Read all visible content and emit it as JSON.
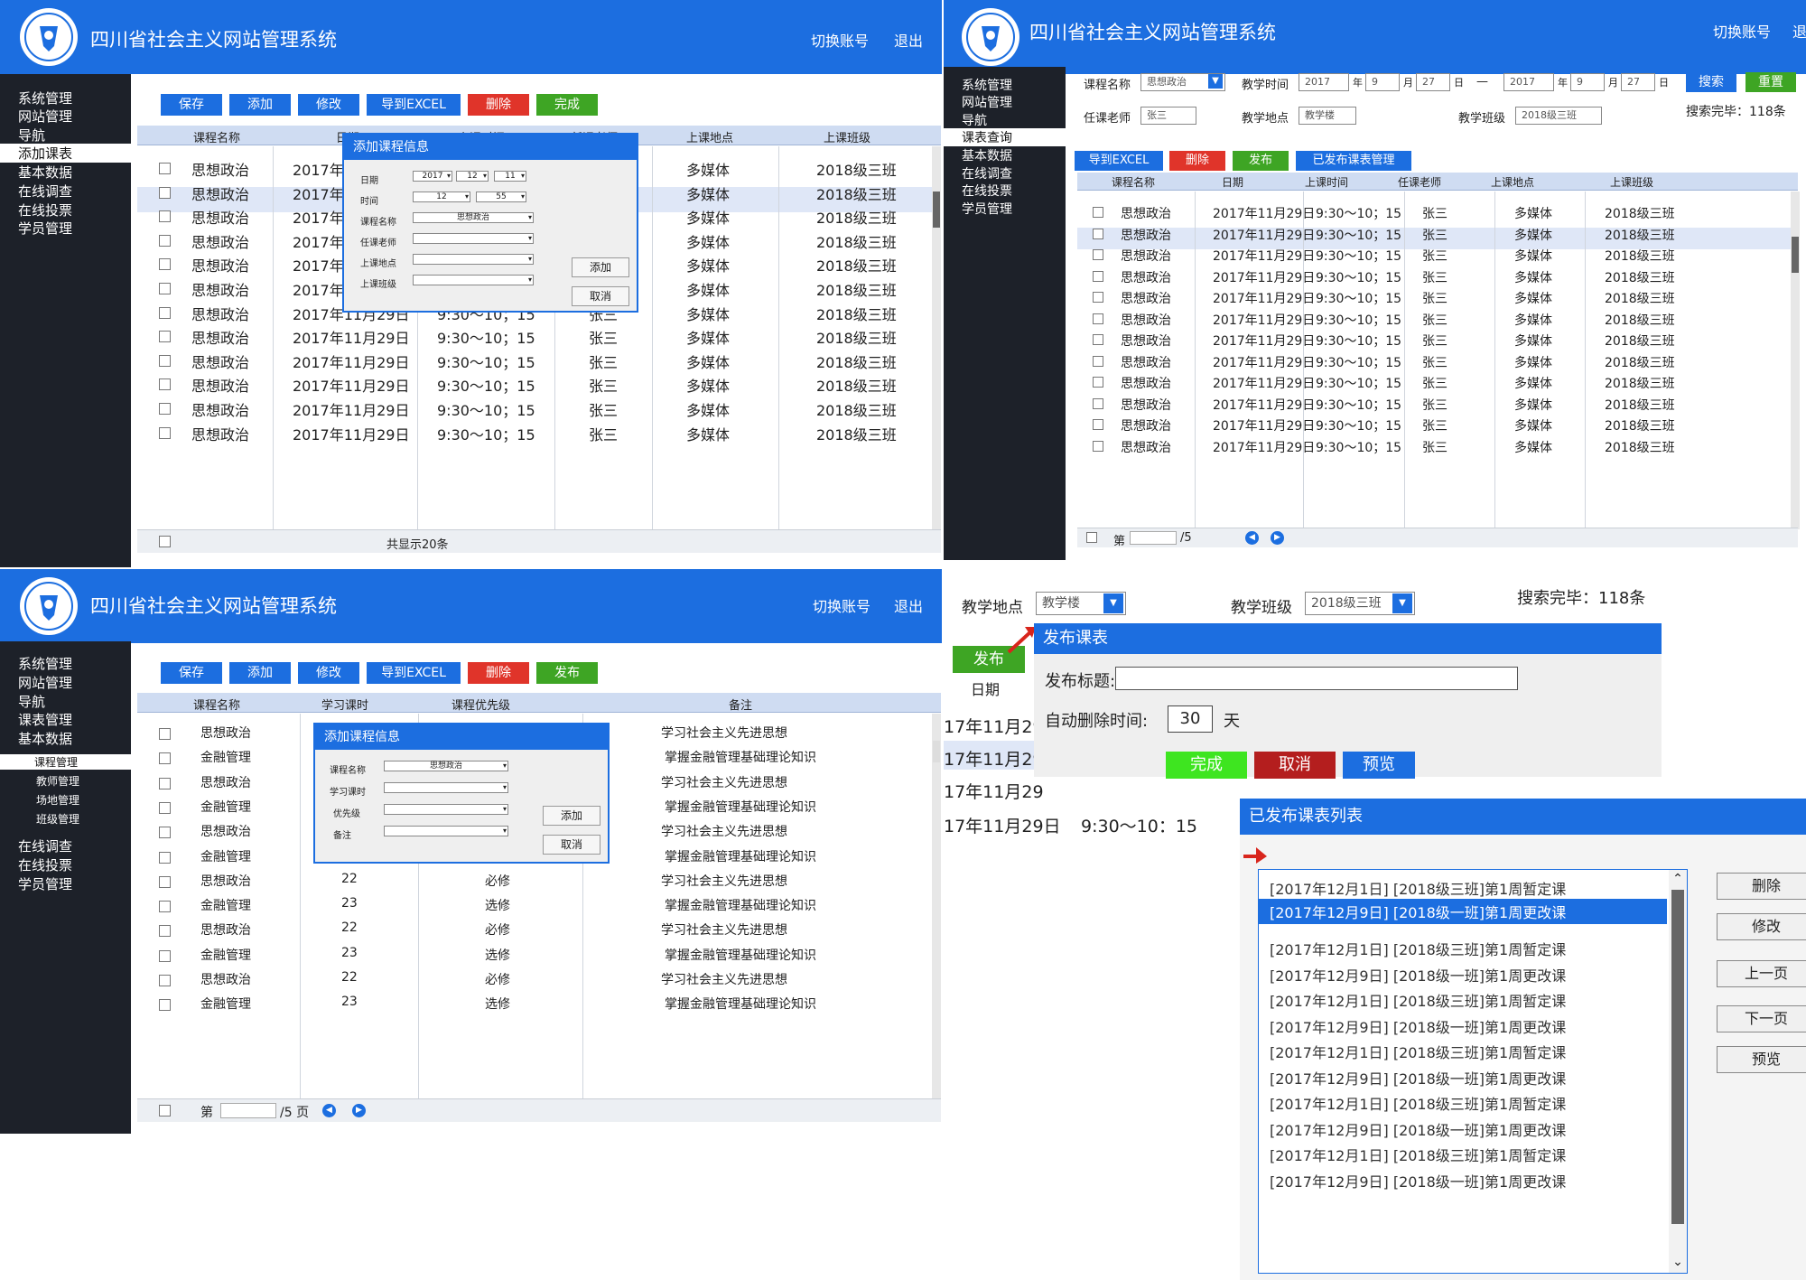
{
  "app": {
    "title": "四川省社会主义网站管理系统",
    "switch": "切换账号",
    "logout": "退出"
  },
  "p1": {
    "sidebar": [
      "系统管理",
      "网站管理",
      "导航",
      "添加课表",
      "基本数据",
      "在线调查",
      "在线投票",
      "学员管理"
    ],
    "toolbar": [
      "保存",
      "添加",
      "修改",
      "导到EXCEL",
      "删除",
      "完成"
    ],
    "columns": [
      "课程名称",
      "日期",
      "上课时间",
      "任课老师",
      "上课地点",
      "上课班级"
    ],
    "rows": [
      [
        "思想政治",
        "2017年11月29日",
        "9:30～10；15",
        "张三",
        "多媒体",
        "2018级三班"
      ],
      [
        "思想政治",
        "2017年11月29日",
        "9:30～10；15",
        "张三",
        "多媒体",
        "2018级三班"
      ],
      [
        "思想政治",
        "2017年11月29日",
        "9:30～10；15",
        "张三",
        "多媒体",
        "2018级三班"
      ],
      [
        "思想政治",
        "2017年11月29日",
        "9:30～10；15",
        "张三",
        "多媒体",
        "2018级三班"
      ],
      [
        "思想政治",
        "2017年11月29日",
        "9:30～10；15",
        "张三",
        "多媒体",
        "2018级三班"
      ],
      [
        "思想政治",
        "2017年11月29日",
        "9:30～10；15",
        "张三",
        "多媒体",
        "2018级三班"
      ],
      [
        "思想政治",
        "2017年11月29日",
        "9:30～10；15",
        "张三",
        "多媒体",
        "2018级三班"
      ],
      [
        "思想政治",
        "2017年11月29日",
        "9:30～10；15",
        "张三",
        "多媒体",
        "2018级三班"
      ],
      [
        "思想政治",
        "2017年11月29日",
        "9:30～10；15",
        "张三",
        "多媒体",
        "2018级三班"
      ],
      [
        "思想政治",
        "2017年11月29日",
        "9:30～10；15",
        "张三",
        "多媒体",
        "2018级三班"
      ],
      [
        "思想政治",
        "2017年11月29日",
        "9:30～10；15",
        "张三",
        "多媒体",
        "2018级三班"
      ],
      [
        "思想政治",
        "2017年11月29日",
        "9:30～10；15",
        "张三",
        "多媒体",
        "2018级三班"
      ]
    ],
    "footer": "共显示20条",
    "dialog": {
      "title": "添加课程信息",
      "date_label": "日期",
      "year": "2017",
      "month": "12",
      "day": "11",
      "time_label": "时间",
      "hour": "12",
      "minute": "55",
      "course_label": "课程名称",
      "course": "思想政治",
      "teacher_label": "任课老师",
      "place_label": "上课地点",
      "class_label": "上课班级",
      "add": "添加",
      "cancel": "取消"
    }
  },
  "p2": {
    "sidebar": [
      "系统管理",
      "网站管理",
      "导航",
      "课表查询",
      "基本数据",
      "在线调查",
      "在线投票",
      "学员管理"
    ],
    "filters": {
      "course_label": "课程名称",
      "course": "思想政治",
      "time_label": "教学时间",
      "y1": "2017",
      "m1": "9",
      "d1": "27",
      "y2": "2017",
      "m2": "9",
      "d2": "27",
      "u_year": "年",
      "u_month": "月",
      "u_day": "日",
      "dash": "—",
      "teacher_label": "任课老师",
      "teacher": "张三",
      "place_label": "教学地点",
      "place": "教学楼",
      "class_label": "教学班级",
      "class": "2018级三班",
      "search": "搜索",
      "reset": "重置",
      "result": "搜索完毕：118条"
    },
    "toolbar": [
      "导到EXCEL",
      "删除",
      "发布",
      "已发布课表管理"
    ],
    "columns": [
      "课程名称",
      "日期",
      "上课时间",
      "任课老师",
      "上课地点",
      "上课班级"
    ],
    "rows": [
      [
        "思想政治",
        "2017年11月29日",
        "9:30～10；15",
        "张三",
        "多媒体",
        "2018级三班"
      ],
      [
        "思想政治",
        "2017年11月29日",
        "9:30～10；15",
        "张三",
        "多媒体",
        "2018级三班"
      ],
      [
        "思想政治",
        "2017年11月29日",
        "9:30～10；15",
        "张三",
        "多媒体",
        "2018级三班"
      ],
      [
        "思想政治",
        "2017年11月29日",
        "9:30～10；15",
        "张三",
        "多媒体",
        "2018级三班"
      ],
      [
        "思想政治",
        "2017年11月29日",
        "9:30～10；15",
        "张三",
        "多媒体",
        "2018级三班"
      ],
      [
        "思想政治",
        "2017年11月29日",
        "9:30～10；15",
        "张三",
        "多媒体",
        "2018级三班"
      ],
      [
        "思想政治",
        "2017年11月29日",
        "9:30～10；15",
        "张三",
        "多媒体",
        "2018级三班"
      ],
      [
        "思想政治",
        "2017年11月29日",
        "9:30～10；15",
        "张三",
        "多媒体",
        "2018级三班"
      ],
      [
        "思想政治",
        "2017年11月29日",
        "9:30～10；15",
        "张三",
        "多媒体",
        "2018级三班"
      ],
      [
        "思想政治",
        "2017年11月29日",
        "9:30～10；15",
        "张三",
        "多媒体",
        "2018级三班"
      ],
      [
        "思想政治",
        "2017年11月29日",
        "9:30～10；15",
        "张三",
        "多媒体",
        "2018级三班"
      ],
      [
        "思想政治",
        "2017年11月29日",
        "9:30～10；15",
        "张三",
        "多媒体",
        "2018级三班"
      ]
    ],
    "footer": {
      "page_prefix": "第",
      "page_total": "/5"
    }
  },
  "p3": {
    "sidebar": [
      "系统管理",
      "网站管理",
      "导航",
      "课表管理",
      "基本数据"
    ],
    "sub": [
      "课程管理",
      "教师管理",
      "场地管理",
      "班级管理"
    ],
    "sidebar2": [
      "在线调查",
      "在线投票",
      "学员管理"
    ],
    "toolbar": [
      "保存",
      "添加",
      "修改",
      "导到EXCEL",
      "删除",
      "发布"
    ],
    "columns": [
      "课程名称",
      "学习课时",
      "课程优先级",
      "备注"
    ],
    "rows": [
      [
        "思想政治",
        "",
        "",
        "学习社会主义先进思想"
      ],
      [
        "金融管理",
        "",
        "",
        "掌握金融管理基础理论知识"
      ],
      [
        "思想政治",
        "",
        "",
        "学习社会主义先进思想"
      ],
      [
        "金融管理",
        "",
        "",
        "掌握金融管理基础理论知识"
      ],
      [
        "思想政治",
        "",
        "",
        "学习社会主义先进思想"
      ],
      [
        "金融管理",
        "23",
        "选修",
        "掌握金融管理基础理论知识"
      ],
      [
        "思想政治",
        "22",
        "必修",
        "学习社会主义先进思想"
      ],
      [
        "金融管理",
        "23",
        "选修",
        "掌握金融管理基础理论知识"
      ],
      [
        "思想政治",
        "22",
        "必修",
        "学习社会主义先进思想"
      ],
      [
        "金融管理",
        "23",
        "选修",
        "掌握金融管理基础理论知识"
      ],
      [
        "思想政治",
        "22",
        "必修",
        "学习社会主义先进思想"
      ],
      [
        "金融管理",
        "23",
        "选修",
        "掌握金融管理基础理论知识"
      ]
    ],
    "footer": {
      "page_prefix": "第",
      "page_total": "/5 页"
    },
    "dialog": {
      "title": "添加课程信息",
      "course_label": "课程名称",
      "course": "思想政治",
      "hours_label": "学习课时",
      "priority_label": "优先级",
      "note_label": "备注",
      "add": "添加",
      "cancel": "取消"
    }
  },
  "p4": {
    "bg": {
      "place_label": "教学地点",
      "place": "教学楼",
      "class_label": "教学班级",
      "class": "2018级三班",
      "result": "搜索完毕：118条",
      "publish": "发布",
      "date_col": "日期",
      "dates": [
        "17年11月29",
        "17年11月29",
        "17年11月29",
        "17年11月29日"
      ],
      "time": "9:30～10：15"
    },
    "publish": {
      "title": "发布课表",
      "title_label": "发布标题:",
      "auto_delete_label": "自动删除时间:",
      "days": "30",
      "days_unit": "天",
      "done": "完成",
      "cancel": "取消",
      "preview": "预览"
    },
    "published": {
      "title": "已发布课表列表",
      "items": [
        "[2017年12月1日] [2018级三班]第1周暂定课",
        "[2017年12月9日] [2018级一班]第1周更改课",
        "[2017年12月1日] [2018级三班]第1周暂定课",
        "[2017年12月9日] [2018级一班]第1周更改课",
        "[2017年12月1日] [2018级三班]第1周暂定课",
        "[2017年12月9日] [2018级一班]第1周更改课",
        "[2017年12月1日] [2018级三班]第1周暂定课",
        "[2017年12月9日] [2018级一班]第1周更改课",
        "[2017年12月1日] [2018级三班]第1周暂定课",
        "[2017年12月9日] [2018级一班]第1周更改课",
        "[2017年12月1日] [2018级三班]第1周暂定课",
        "[2017年12月9日] [2018级一班]第1周更改课"
      ],
      "buttons": [
        "删除",
        "修改",
        "上一页",
        "下一页",
        "预览"
      ]
    }
  },
  "colors": {
    "primary": "#1c6ee0",
    "sidebar": "#1d2129",
    "danger": "#e0342a",
    "success": "#3ea524",
    "header_row": "#cfdcf2",
    "selected_row": "#dfe7f7"
  }
}
